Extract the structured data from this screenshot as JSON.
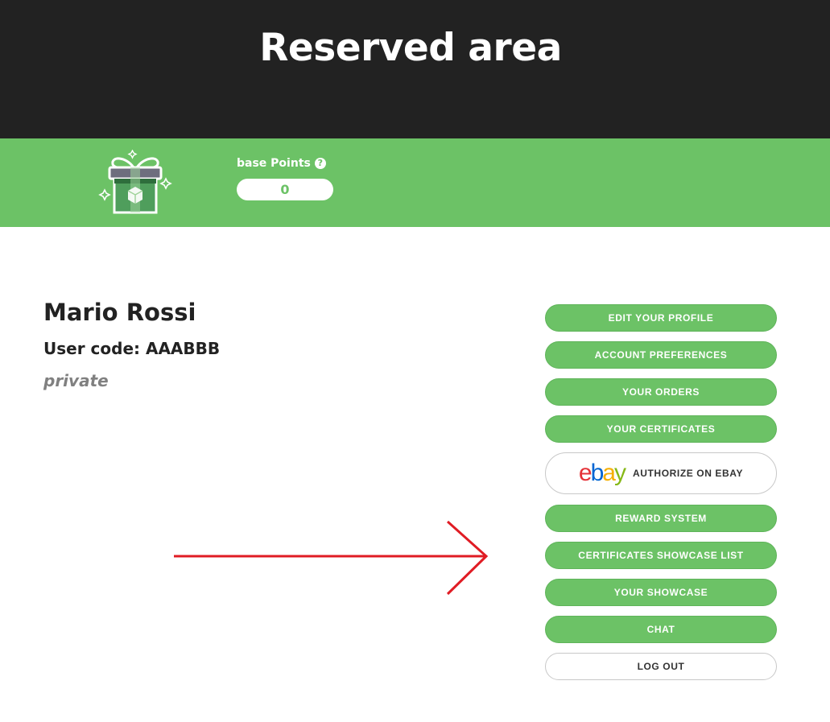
{
  "header": {
    "title": "Reserved area"
  },
  "points": {
    "label": "base Points",
    "help_icon": "question-circle-icon",
    "value": "0",
    "gift_icon": "gift-box-icon"
  },
  "user": {
    "name": "Mario Rossi",
    "code_label": "User code: AAABBB",
    "type": "private"
  },
  "menu": {
    "edit_profile": "EDIT YOUR PROFILE",
    "account_preferences": "ACCOUNT PREFERENCES",
    "your_orders": "YOUR ORDERS",
    "your_certificates": "YOUR CERTIFICATES",
    "ebay_logo": [
      "e",
      "b",
      "a",
      "y"
    ],
    "authorize_ebay": "AUTHORIZE ON EBAY",
    "reward_system": "REWARD SYSTEM",
    "certificates_showcase_list": "CERTIFICATES SHOWCASE LIST",
    "your_showcase": "YOUR SHOWCASE",
    "chat": "CHAT",
    "log_out": "LOG OUT"
  },
  "colors": {
    "header_bg": "#222222",
    "accent_green": "#6cc266",
    "arrow_red": "#e01c24",
    "muted_text": "#808080"
  }
}
